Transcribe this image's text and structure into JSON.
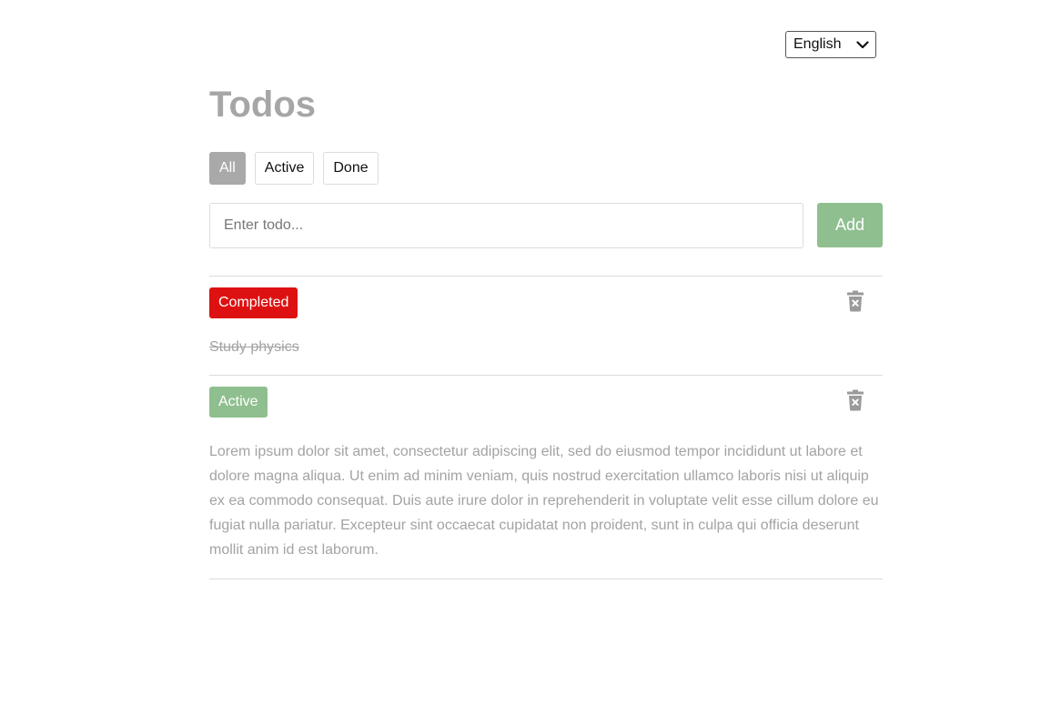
{
  "language": {
    "selected": "English"
  },
  "header": {
    "title": "Todos"
  },
  "filters": [
    {
      "label": "All",
      "selected": true
    },
    {
      "label": "Active",
      "selected": false
    },
    {
      "label": "Done",
      "selected": false
    }
  ],
  "new_todo": {
    "placeholder": "Enter todo...",
    "value": "",
    "add_label": "Add"
  },
  "todos": [
    {
      "status_label": "Completed",
      "text": "Study physics"
    },
    {
      "status_label": "Active",
      "text": "Lorem ipsum dolor sit amet, consectetur adipiscing elit, sed do eiusmod tempor incididunt ut labore et dolore magna aliqua. Ut enim ad minim veniam, quis nostrud exercitation ullamco laboris nisi ut aliquip ex ea commodo consequat. Duis aute irure dolor in reprehenderit in voluptate velit esse cillum dolore eu fugiat nulla pariatur. Excepteur sint occaecat cupidatat non proident, sunt in culpa qui officia deserunt mollit anim id est laborum."
    }
  ],
  "icons": {
    "language_dropdown": "chevron-down-icon",
    "delete": "trash-icon"
  },
  "colors": {
    "title": "#a6a6a6",
    "filter_selected": "#a9a9a9",
    "add_button": "#8fbf8f",
    "badge_completed": "#dd1111",
    "badge_active": "#8fbf8f",
    "todo_text": "#a3a3a3",
    "icon": "#9a9a9a"
  }
}
